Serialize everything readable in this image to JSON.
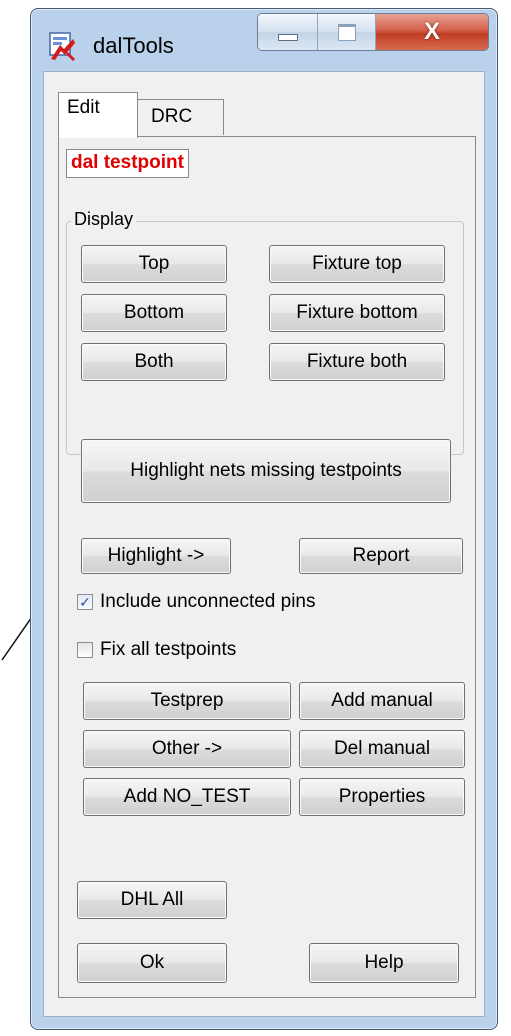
{
  "window": {
    "title": "dalTools",
    "close_glyph": "X",
    "icons": {
      "app": "daltools-app-icon",
      "minimize": "minimize-icon",
      "maximize": "maximize-icon",
      "close": "close-icon"
    }
  },
  "tabs": [
    {
      "label": "Edit",
      "selected": true
    },
    {
      "label": "DRC",
      "selected": false
    }
  ],
  "edit": {
    "module_label": "dal testpoint",
    "display_group": {
      "title": "Display",
      "buttons": {
        "top": "Top",
        "fixture_top": "Fixture top",
        "bottom": "Bottom",
        "fixture_bottom": "Fixture bottom",
        "both": "Both",
        "fixture_both": "Fixture both"
      }
    },
    "highlight_missing": "Highlight nets missing testpoints",
    "highlight_menu": "Highlight ->",
    "report": "Report",
    "include_unconnected": {
      "label": "Include unconnected pins",
      "checked": true
    },
    "fix_all": {
      "label": "Fix all testpoints",
      "checked": false
    },
    "testprep": "Testprep",
    "add_manual": "Add manual",
    "other_menu": "Other ->",
    "del_manual": "Del manual",
    "add_no_test": "Add NO_TEST",
    "properties": "Properties",
    "dhl_all": "DHL All",
    "ok": "Ok",
    "help": "Help"
  },
  "colors": {
    "frame": "#b9d1ea",
    "client": "#f0f0f0",
    "module_label_text": "#e00000",
    "close_button": "#c9472e"
  }
}
